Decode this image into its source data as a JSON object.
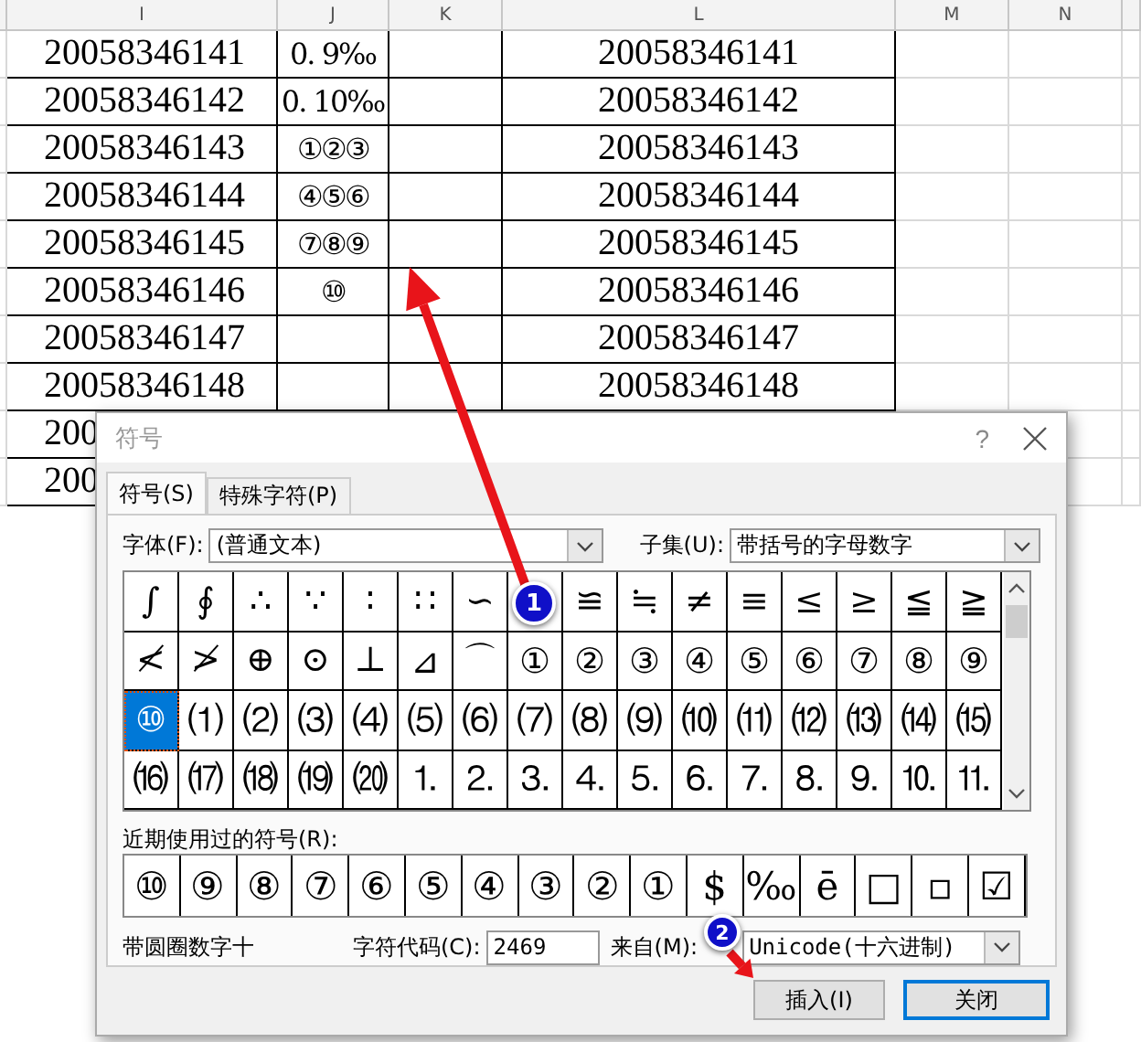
{
  "spreadsheet": {
    "columns": [
      "I",
      "J",
      "K",
      "L",
      "M",
      "N"
    ],
    "rows": [
      {
        "i": "20058346141",
        "j": "0. 9‰",
        "l": "20058346141"
      },
      {
        "i": "20058346142",
        "j": "0. 10‰",
        "l": "20058346142"
      },
      {
        "i": "20058346143",
        "j": "①②③",
        "l": "20058346143"
      },
      {
        "i": "20058346144",
        "j": "④⑤⑥",
        "l": "20058346144"
      },
      {
        "i": "20058346145",
        "j": "⑦⑧⑨",
        "l": "20058346145"
      },
      {
        "i": "20058346146",
        "j": "⑩",
        "l": "20058346146"
      },
      {
        "i": "20058346147",
        "l": "20058346147"
      },
      {
        "i": "20058346148",
        "l": "20058346148"
      },
      {
        "i": "200"
      },
      {
        "i": "200"
      }
    ]
  },
  "dialog": {
    "title": "符号",
    "help": "?",
    "tabs": [
      {
        "label": "符号(S)",
        "selected": true
      },
      {
        "label": "特殊字符(P)",
        "selected": false
      }
    ],
    "font": {
      "label": "字体(F):",
      "value": "(普通文本)"
    },
    "subset": {
      "label": "子集(U):",
      "value": "带括号的字母数字"
    },
    "symbols": [
      {
        "symbol": "∫",
        "selected": false
      },
      {
        "symbol": "∮",
        "selected": false
      },
      {
        "symbol": "∴",
        "selected": false
      },
      {
        "symbol": "∵",
        "selected": false
      },
      {
        "symbol": "∶",
        "selected": false
      },
      {
        "symbol": "∷",
        "selected": false
      },
      {
        "symbol": "∽",
        "selected": false
      },
      {
        "selected": false
      },
      {
        "symbol": "≌",
        "selected": false
      },
      {
        "symbol": "≒",
        "selected": false
      },
      {
        "symbol": "≠",
        "selected": false
      },
      {
        "symbol": "≡",
        "selected": false
      },
      {
        "symbol": "≤",
        "selected": false
      },
      {
        "symbol": "≥",
        "selected": false
      },
      {
        "symbol": "≦",
        "selected": false
      },
      {
        "symbol": "≧",
        "selected": false
      },
      {
        "symbol": "≮",
        "selected": false
      },
      {
        "symbol": "≯",
        "selected": false
      },
      {
        "symbol": "⊕",
        "selected": false
      },
      {
        "symbol": "⊙",
        "selected": false
      },
      {
        "symbol": "⊥",
        "selected": false
      },
      {
        "symbol": "⊿",
        "selected": false
      },
      {
        "symbol": "⌒",
        "selected": false
      },
      {
        "symbol": "①",
        "selected": false
      },
      {
        "symbol": "②",
        "selected": false
      },
      {
        "symbol": "③",
        "selected": false
      },
      {
        "symbol": "④",
        "selected": false
      },
      {
        "symbol": "⑤",
        "selected": false
      },
      {
        "symbol": "⑥",
        "selected": false
      },
      {
        "symbol": "⑦",
        "selected": false
      },
      {
        "symbol": "⑧",
        "selected": false
      },
      {
        "symbol": "⑨",
        "selected": false
      },
      {
        "symbol": "⑩",
        "selected": true
      },
      {
        "symbol": "⑴",
        "selected": false
      },
      {
        "symbol": "⑵",
        "selected": false
      },
      {
        "symbol": "⑶",
        "selected": false
      },
      {
        "symbol": "⑷",
        "selected": false
      },
      {
        "symbol": "⑸",
        "selected": false
      },
      {
        "symbol": "⑹",
        "selected": false
      },
      {
        "symbol": "⑺",
        "selected": false
      },
      {
        "symbol": "⑻",
        "selected": false
      },
      {
        "symbol": "⑼",
        "selected": false
      },
      {
        "symbol": "⑽",
        "selected": false
      },
      {
        "symbol": "⑾",
        "selected": false
      },
      {
        "symbol": "⑿",
        "selected": false
      },
      {
        "symbol": "⒀",
        "selected": false
      },
      {
        "symbol": "⒁",
        "selected": false
      },
      {
        "symbol": "⒂",
        "selected": false
      },
      {
        "symbol": "⒃",
        "selected": false
      },
      {
        "symbol": "⒄",
        "selected": false
      },
      {
        "symbol": "⒅",
        "selected": false
      },
      {
        "symbol": "⒆",
        "selected": false
      },
      {
        "symbol": "⒇",
        "selected": false
      },
      {
        "symbol": "⒈",
        "selected": false
      },
      {
        "symbol": "⒉",
        "selected": false
      },
      {
        "symbol": "⒊",
        "selected": false
      },
      {
        "symbol": "⒋",
        "selected": false
      },
      {
        "symbol": "⒌",
        "selected": false
      },
      {
        "symbol": "⒍",
        "selected": false
      },
      {
        "symbol": "⒎",
        "selected": false
      },
      {
        "symbol": "⒏",
        "selected": false
      },
      {
        "symbol": "⒐",
        "selected": false
      },
      {
        "symbol": "⒑",
        "selected": false
      },
      {
        "symbol": "⒒",
        "selected": false
      }
    ],
    "recent": {
      "label": "近期使用过的符号(R):",
      "symbols": [
        "⑩",
        "⑨",
        "⑧",
        "⑦",
        "⑥",
        "⑤",
        "④",
        "③",
        "②",
        "①",
        "$",
        "‰",
        "ē",
        "□",
        "▫",
        "☑"
      ]
    },
    "char_name": "带圆圈数字十",
    "code": {
      "label": "字符代码(C):",
      "value": "2469"
    },
    "from": {
      "label": "来自(M):",
      "value": "Unicode(十六进制)"
    },
    "buttons": [
      {
        "label": "插入(I)",
        "default": false
      },
      {
        "label": "关闭",
        "default": true
      }
    ]
  },
  "annotations": [
    {
      "number": "1"
    },
    {
      "number": "2"
    }
  ]
}
